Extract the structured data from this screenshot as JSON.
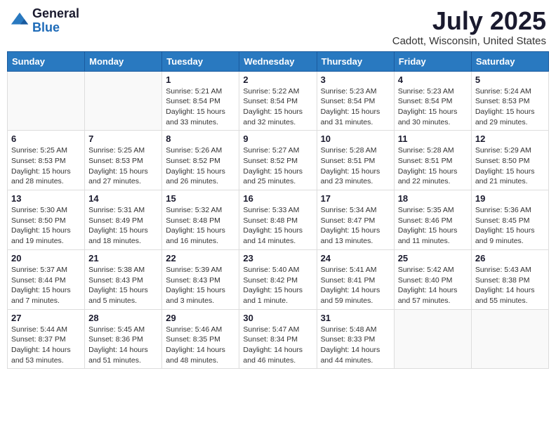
{
  "header": {
    "logo_general": "General",
    "logo_blue": "Blue",
    "month_title": "July 2025",
    "location": "Cadott, Wisconsin, United States"
  },
  "days_of_week": [
    "Sunday",
    "Monday",
    "Tuesday",
    "Wednesday",
    "Thursday",
    "Friday",
    "Saturday"
  ],
  "weeks": [
    [
      {
        "day": "",
        "info": ""
      },
      {
        "day": "",
        "info": ""
      },
      {
        "day": "1",
        "info": "Sunrise: 5:21 AM\nSunset: 8:54 PM\nDaylight: 15 hours\nand 33 minutes."
      },
      {
        "day": "2",
        "info": "Sunrise: 5:22 AM\nSunset: 8:54 PM\nDaylight: 15 hours\nand 32 minutes."
      },
      {
        "day": "3",
        "info": "Sunrise: 5:23 AM\nSunset: 8:54 PM\nDaylight: 15 hours\nand 31 minutes."
      },
      {
        "day": "4",
        "info": "Sunrise: 5:23 AM\nSunset: 8:54 PM\nDaylight: 15 hours\nand 30 minutes."
      },
      {
        "day": "5",
        "info": "Sunrise: 5:24 AM\nSunset: 8:53 PM\nDaylight: 15 hours\nand 29 minutes."
      }
    ],
    [
      {
        "day": "6",
        "info": "Sunrise: 5:25 AM\nSunset: 8:53 PM\nDaylight: 15 hours\nand 28 minutes."
      },
      {
        "day": "7",
        "info": "Sunrise: 5:25 AM\nSunset: 8:53 PM\nDaylight: 15 hours\nand 27 minutes."
      },
      {
        "day": "8",
        "info": "Sunrise: 5:26 AM\nSunset: 8:52 PM\nDaylight: 15 hours\nand 26 minutes."
      },
      {
        "day": "9",
        "info": "Sunrise: 5:27 AM\nSunset: 8:52 PM\nDaylight: 15 hours\nand 25 minutes."
      },
      {
        "day": "10",
        "info": "Sunrise: 5:28 AM\nSunset: 8:51 PM\nDaylight: 15 hours\nand 23 minutes."
      },
      {
        "day": "11",
        "info": "Sunrise: 5:28 AM\nSunset: 8:51 PM\nDaylight: 15 hours\nand 22 minutes."
      },
      {
        "day": "12",
        "info": "Sunrise: 5:29 AM\nSunset: 8:50 PM\nDaylight: 15 hours\nand 21 minutes."
      }
    ],
    [
      {
        "day": "13",
        "info": "Sunrise: 5:30 AM\nSunset: 8:50 PM\nDaylight: 15 hours\nand 19 minutes."
      },
      {
        "day": "14",
        "info": "Sunrise: 5:31 AM\nSunset: 8:49 PM\nDaylight: 15 hours\nand 18 minutes."
      },
      {
        "day": "15",
        "info": "Sunrise: 5:32 AM\nSunset: 8:48 PM\nDaylight: 15 hours\nand 16 minutes."
      },
      {
        "day": "16",
        "info": "Sunrise: 5:33 AM\nSunset: 8:48 PM\nDaylight: 15 hours\nand 14 minutes."
      },
      {
        "day": "17",
        "info": "Sunrise: 5:34 AM\nSunset: 8:47 PM\nDaylight: 15 hours\nand 13 minutes."
      },
      {
        "day": "18",
        "info": "Sunrise: 5:35 AM\nSunset: 8:46 PM\nDaylight: 15 hours\nand 11 minutes."
      },
      {
        "day": "19",
        "info": "Sunrise: 5:36 AM\nSunset: 8:45 PM\nDaylight: 15 hours\nand 9 minutes."
      }
    ],
    [
      {
        "day": "20",
        "info": "Sunrise: 5:37 AM\nSunset: 8:44 PM\nDaylight: 15 hours\nand 7 minutes."
      },
      {
        "day": "21",
        "info": "Sunrise: 5:38 AM\nSunset: 8:43 PM\nDaylight: 15 hours\nand 5 minutes."
      },
      {
        "day": "22",
        "info": "Sunrise: 5:39 AM\nSunset: 8:43 PM\nDaylight: 15 hours\nand 3 minutes."
      },
      {
        "day": "23",
        "info": "Sunrise: 5:40 AM\nSunset: 8:42 PM\nDaylight: 15 hours\nand 1 minute."
      },
      {
        "day": "24",
        "info": "Sunrise: 5:41 AM\nSunset: 8:41 PM\nDaylight: 14 hours\nand 59 minutes."
      },
      {
        "day": "25",
        "info": "Sunrise: 5:42 AM\nSunset: 8:40 PM\nDaylight: 14 hours\nand 57 minutes."
      },
      {
        "day": "26",
        "info": "Sunrise: 5:43 AM\nSunset: 8:38 PM\nDaylight: 14 hours\nand 55 minutes."
      }
    ],
    [
      {
        "day": "27",
        "info": "Sunrise: 5:44 AM\nSunset: 8:37 PM\nDaylight: 14 hours\nand 53 minutes."
      },
      {
        "day": "28",
        "info": "Sunrise: 5:45 AM\nSunset: 8:36 PM\nDaylight: 14 hours\nand 51 minutes."
      },
      {
        "day": "29",
        "info": "Sunrise: 5:46 AM\nSunset: 8:35 PM\nDaylight: 14 hours\nand 48 minutes."
      },
      {
        "day": "30",
        "info": "Sunrise: 5:47 AM\nSunset: 8:34 PM\nDaylight: 14 hours\nand 46 minutes."
      },
      {
        "day": "31",
        "info": "Sunrise: 5:48 AM\nSunset: 8:33 PM\nDaylight: 14 hours\nand 44 minutes."
      },
      {
        "day": "",
        "info": ""
      },
      {
        "day": "",
        "info": ""
      }
    ]
  ]
}
